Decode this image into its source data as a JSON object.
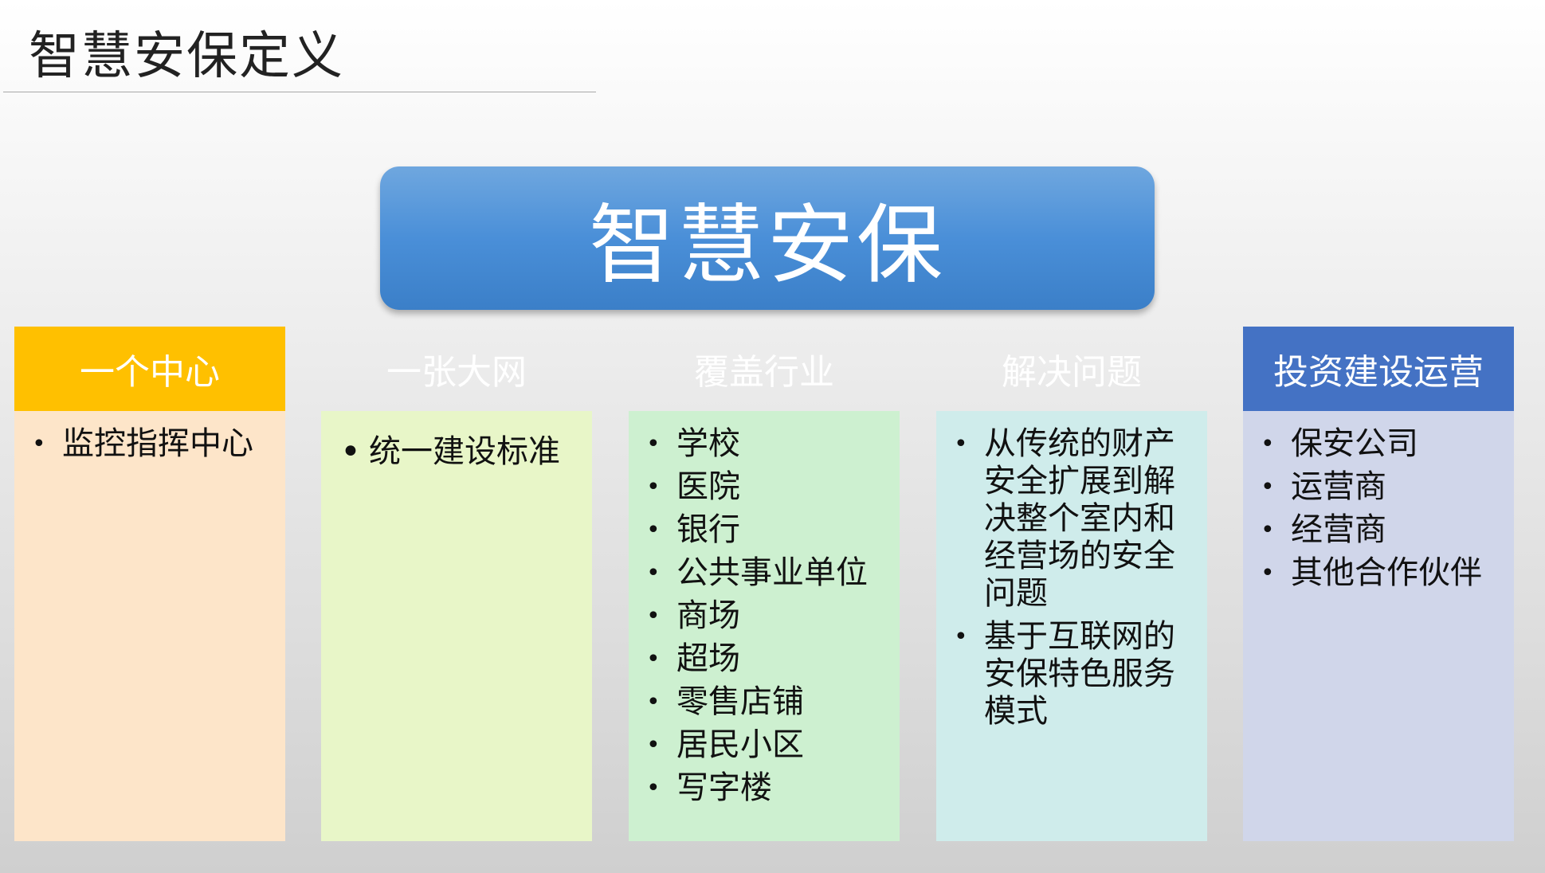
{
  "slide": {
    "title": "智慧安保定义",
    "main_label": "智慧安保"
  },
  "colors": {
    "main_box": "#4a8fd8",
    "col1_header": "#ffc000",
    "col1_body": "#fde5c9",
    "col2_body": "#e8f6c8",
    "col3_body": "#cdf0d0",
    "col4_body": "#cfeceb",
    "col5_header": "#4472c4",
    "col5_body": "#d0d6ea"
  },
  "columns": [
    {
      "header": "一个中心",
      "items": [
        "监控指挥中心"
      ]
    },
    {
      "header": "一张大网",
      "items": [
        "统一建设标准"
      ]
    },
    {
      "header": "覆盖行业",
      "items": [
        "学校",
        "医院",
        "银行",
        "公共事业单位",
        "商场",
        "超场",
        "零售店铺",
        "居民小区",
        "写字楼"
      ]
    },
    {
      "header": "解决问题",
      "items": [
        "从传统的财产安全扩展到解决整个室内和经营场的安全问题",
        "基于互联网的安保特色服务模式"
      ]
    },
    {
      "header": "投资建设运营",
      "items": [
        "保安公司",
        "运营商",
        "经营商",
        "其他合作伙伴"
      ]
    }
  ]
}
